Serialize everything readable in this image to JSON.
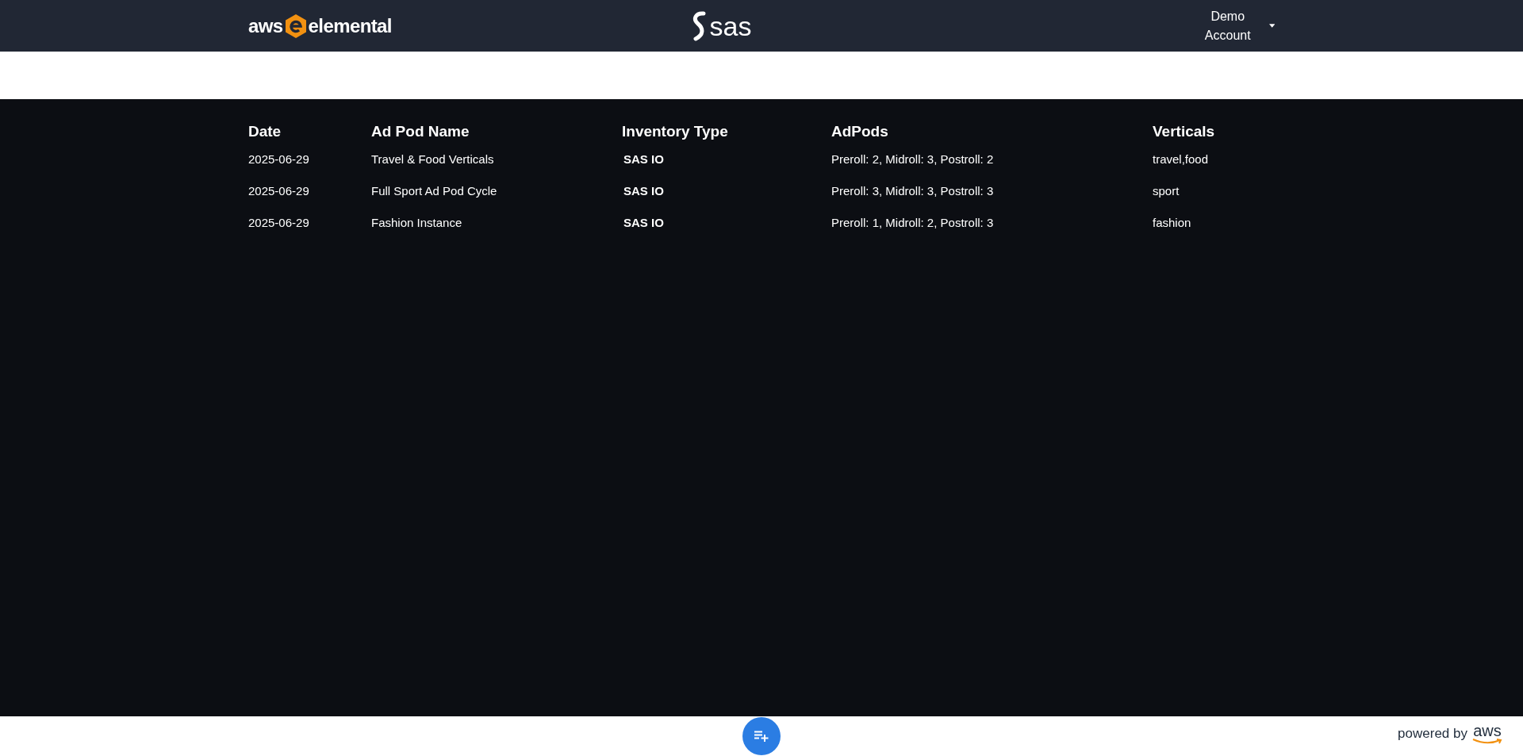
{
  "header": {
    "brand_left": {
      "prefix": "aws",
      "suffix": "elemental"
    },
    "brand_center": "sas",
    "account_menu": "Demo Account"
  },
  "table": {
    "columns": [
      "Date",
      "Ad Pod Name",
      "Inventory Type",
      "AdPods",
      "Verticals"
    ],
    "rows": [
      {
        "date": "2025-06-29",
        "name": "Travel & Food Verticals",
        "inventory_type": "SAS IO",
        "adpods": "Preroll: 2, Midroll: 3, Postroll: 2",
        "verticals": "travel,food"
      },
      {
        "date": "2025-06-29",
        "name": "Full Sport Ad Pod Cycle",
        "inventory_type": "SAS IO",
        "adpods": "Preroll: 3, Midroll: 3, Postroll: 3",
        "verticals": "sport"
      },
      {
        "date": "2025-06-29",
        "name": "Fashion Instance",
        "inventory_type": "SAS IO",
        "adpods": "Preroll: 1, Midroll: 2, Postroll: 3",
        "verticals": "fashion"
      }
    ]
  },
  "footer": {
    "powered_by": "powered by",
    "brand": "aws"
  }
}
